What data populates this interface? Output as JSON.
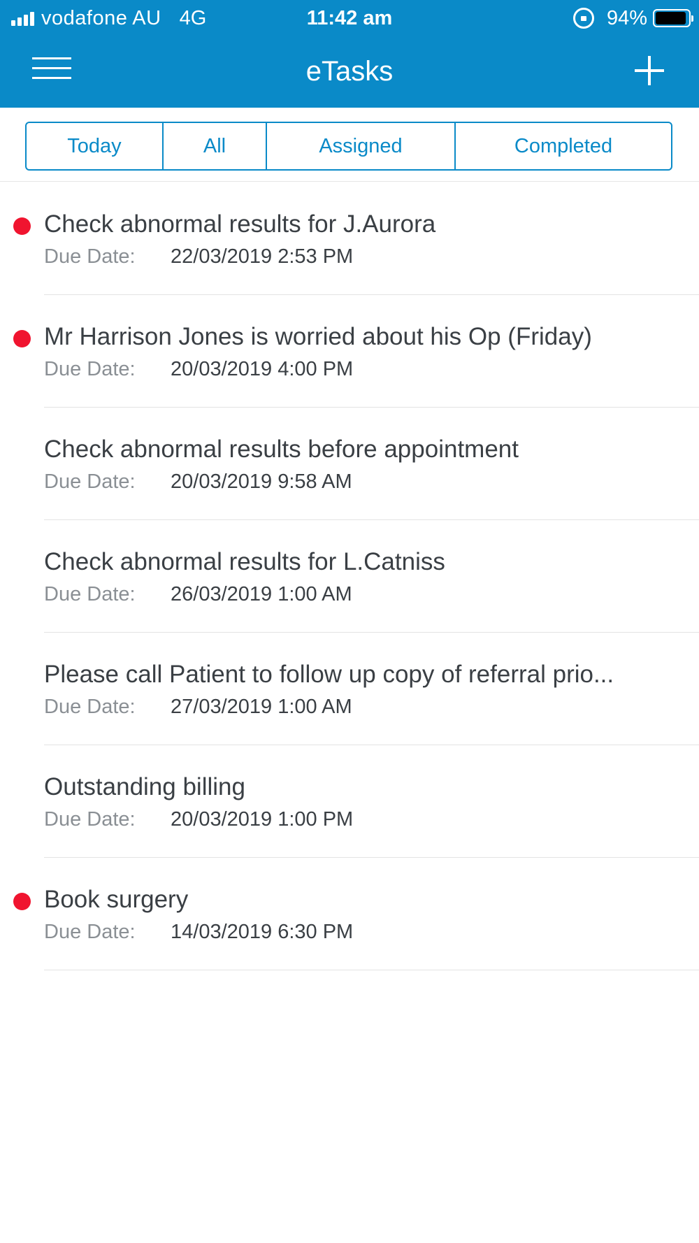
{
  "status_bar": {
    "carrier": "vodafone AU",
    "network": "4G",
    "time": "11:42 am",
    "battery": "94%",
    "battery_level": 0.94,
    "icons": [
      "signal-icon",
      "rotation-lock-icon",
      "battery-icon"
    ]
  },
  "navbar": {
    "title": "eTasks",
    "menu_icon": "hamburger-menu-icon",
    "add_icon": "plus-icon"
  },
  "tabs": [
    {
      "label": "Today"
    },
    {
      "label": "All"
    },
    {
      "label": "Assigned"
    },
    {
      "label": "Completed"
    }
  ],
  "due_label": "Due Date:",
  "tasks": [
    {
      "title": "Check abnormal results for J.Aurora",
      "due": "22/03/2019 2:53 PM",
      "urgent": true
    },
    {
      "title": "Mr Harrison Jones is worried about his Op (Friday)",
      "due": "20/03/2019 4:00 PM",
      "urgent": true
    },
    {
      "title": "Check abnormal results before appointment",
      "due": "20/03/2019 9:58 AM",
      "urgent": false
    },
    {
      "title": "Check abnormal results for L.Catniss",
      "due": "26/03/2019 1:00 AM",
      "urgent": false
    },
    {
      "title": "Please call Patient to follow up copy of referral prio...",
      "due": "27/03/2019 1:00 AM",
      "urgent": false
    },
    {
      "title": "Outstanding billing",
      "due": "20/03/2019 1:00 PM",
      "urgent": false
    },
    {
      "title": "Book surgery",
      "due": "14/03/2019 6:30 PM",
      "urgent": true
    }
  ],
  "colors": {
    "accent": "#0a8ac8",
    "urgent_dot": "#f0142f",
    "text": "#3a3f44",
    "muted": "#8a8f94"
  }
}
